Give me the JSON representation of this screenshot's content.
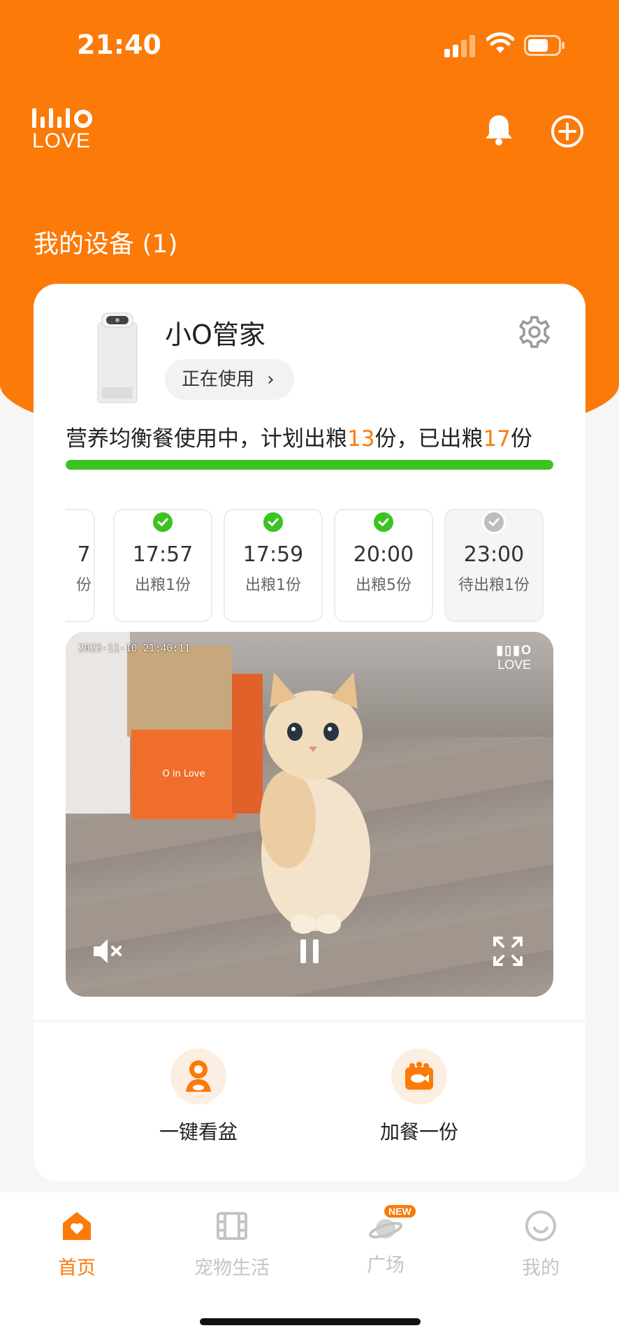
{
  "status_bar": {
    "time": "21:40"
  },
  "brand": {
    "logo_text": "LOVE"
  },
  "section": {
    "title": "我的设备 (1)"
  },
  "device": {
    "name": "小O管家",
    "status_label": "正在使用",
    "status_chevron": "›",
    "plan_prefix": "营养均衡餐使用中，计划出粮",
    "planned": "13",
    "plan_mid": "份，已出粮",
    "dispensed": "17",
    "plan_suffix": "份",
    "progress": 1.0
  },
  "schedule": [
    {
      "time": "7",
      "status": "份",
      "state": "done"
    },
    {
      "time": "17:57",
      "status": "出粮1份",
      "state": "done"
    },
    {
      "time": "17:59",
      "status": "出粮1份",
      "state": "done"
    },
    {
      "time": "20:00",
      "status": "出粮5份",
      "state": "done"
    },
    {
      "time": "23:00",
      "status": "待出粮1份",
      "state": "pending"
    }
  ],
  "video": {
    "timestamp": "2023-11-10 21:40:11",
    "watermark": "LOVE",
    "box_label": "O in Love"
  },
  "actions": [
    {
      "label": "一键看盆",
      "icon": "camera-person-icon"
    },
    {
      "label": "加餐一份",
      "icon": "food-bowl-icon"
    }
  ],
  "tabs": [
    {
      "label": "首页",
      "icon": "home-icon",
      "active": true
    },
    {
      "label": "宠物生活",
      "icon": "film-icon",
      "active": false
    },
    {
      "label": "广场",
      "icon": "planet-icon",
      "active": false,
      "badge": "NEW"
    },
    {
      "label": "我的",
      "icon": "smiley-icon",
      "active": false
    }
  ],
  "colors": {
    "accent": "#fb7a08",
    "progress": "#3cc321",
    "check_done": "#3cc321",
    "check_pending": "#bdbdbd"
  }
}
